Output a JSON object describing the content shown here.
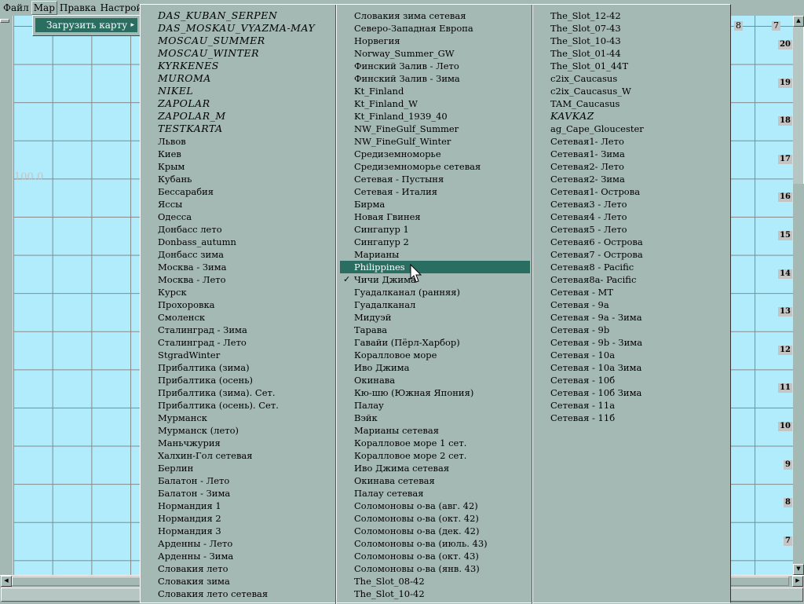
{
  "menubar": {
    "items": [
      "Файл",
      "Мар",
      "Правка",
      "Настрой"
    ],
    "open_index": 1
  },
  "submenu": {
    "item": "Загрузить карту",
    "arrow": "▸"
  },
  "map": {
    "scale_label": "100.0",
    "column_labels": [
      "8",
      "7"
    ],
    "row_labels": [
      "20",
      "19",
      "18",
      "17",
      "16",
      "15",
      "14",
      "13",
      "12",
      "11",
      "10",
      "9",
      "8",
      "7"
    ],
    "background_color": "#b0ecfc"
  },
  "dropdown": {
    "highlight_color": "#2a6e62",
    "checked_item": "Чичи Джима",
    "hovered_item": "Philippines",
    "columns": [
      [
        "DAS_KUBAN_SERPEN",
        "DAS_MOSKAU_VYAZMA-MAY",
        "MOSCAU_SUMMER",
        "MOSCAU_WINTER",
        "KYRKENES",
        "MUROMA",
        "NIKEL",
        "ZAPOLAR",
        "ZAPOLAR_M",
        "TESTKARTA",
        "Львов",
        "Киев",
        "Крым",
        "Кубань",
        "Бессарабия",
        "Яссы",
        "Одесса",
        "Донбасс лето",
        "Donbass_autumn",
        "Донбасс зима",
        "Москва - Зима",
        "Москва - Лето",
        "Курск",
        "Прохоровка",
        "Смоленск",
        "Сталинград - Зима",
        "Сталинград - Лето",
        "StgradWinter",
        "Прибалтика (зима)",
        "Прибалтика (осень)",
        "Прибалтика (зима). Сет.",
        "Прибалтика (осень). Сет.",
        "Мурманск",
        "Мурманск (лето)",
        "Маньчжурия",
        "Халхин-Гол сетевая",
        "Берлин",
        "Балатон - Лето",
        "Балатон - Зима",
        "Нормандия 1",
        "Нормандия 2",
        "Нормандия 3",
        "Арденны - Лето",
        "Арденны - Зима",
        "Словакия лето",
        "Словакия зима",
        "Словакия лето сетевая"
      ],
      [
        "Словакия зима сетевая",
        "Северо-Западная Европа",
        "Норвегия",
        "Norway_Summer_GW",
        "Финский Залив - Лето",
        "Финский Залив - Зима",
        "Kt_Finland",
        "Kt_Finland_W",
        "Kt_Finland_1939_40",
        "NW_FineGulf_Summer",
        "NW_FineGulf_Winter",
        "Средиземноморье",
        "Средиземноморье сетевая",
        "Сетевая - Пустыня",
        "Сетевая - Италия",
        "Бирма",
        "Новая Гвинея",
        "Сингапур 1",
        "Сингапур 2",
        "Марианы",
        "Philippines",
        "Чичи Джима",
        "Гуадалканал (ранняя)",
        "Гуадалканал",
        "Мидуэй",
        "Тарава",
        "Гавайи (Пёрл-Харбор)",
        "Коралловое море",
        "Иво Джима",
        "Окинава",
        "Кю-шю (Южная Япония)",
        "Палау",
        "Вэйк",
        "Марианы сетевая",
        "Коралловое море 1 сет.",
        "Коралловое море 2 сет.",
        "Иво Джима сетевая",
        "Окинава сетевая",
        "Палау сетевая",
        "Соломоновы о-ва (авг. 42)",
        "Соломоновы о-ва (окт. 42)",
        "Соломоновы о-ва (дек. 42)",
        "Соломоновы о-ва (июль. 43)",
        "Соломоновы о-ва (окт. 43)",
        "Соломоновы о-ва (янв. 43)",
        "The_Slot_08-42",
        "The_Slot_10-42"
      ],
      [
        "The_Slot_12-42",
        "The_Slot_07-43",
        "The_Slot_10-43",
        "The_Slot_01-44",
        "The_Slot_01_44T",
        "c2ix_Caucasus",
        "c2ix_Caucasus_W",
        "TAM_Caucasus",
        "KAVKAZ",
        "ag_Cape_Gloucester",
        "Сетевая1- Лето",
        "Сетевая1- Зима",
        "Сетевая2- Лето",
        "Сетевая2- Зима",
        "Сетевая1- Острова",
        "Сетевая3 - Лето",
        "Сетевая4 - Лето",
        "Сетевая5 - Лето",
        "Сетевая6 - Острова",
        "Сетевая7 - Острова",
        "Сетевая8 - Pacific",
        "Сетевая8а- Pacific",
        "Сетевая - MT",
        "Сетевая - 9a",
        "Сетевая - 9a - Зима",
        "Сетевая - 9b",
        "Сетевая - 9b - Зима",
        "Сетевая - 10а",
        "Сетевая - 10а Зима",
        "Сетевая - 10б",
        "Сетевая - 10б Зима",
        "Сетевая - 11а",
        "Сетевая - 11б"
      ]
    ]
  }
}
